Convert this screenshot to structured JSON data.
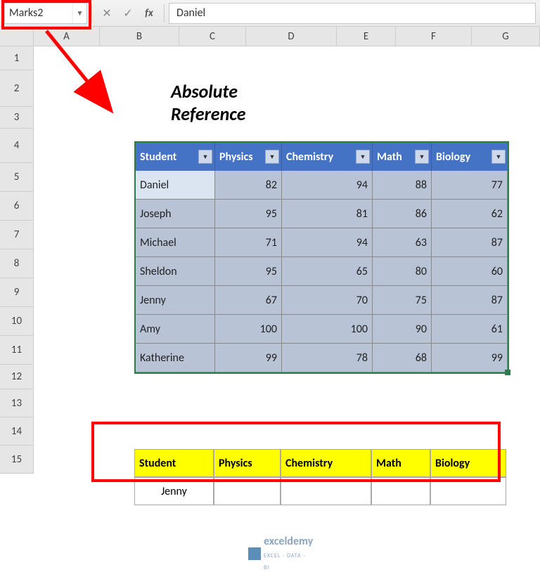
{
  "formula_bar": {
    "name_box": "Marks2",
    "formula_value": "Daniel",
    "cancel": "✕",
    "confirm": "✓",
    "fx": "fx"
  },
  "columns": [
    "A",
    "B",
    "C",
    "D",
    "E",
    "F",
    "G"
  ],
  "rows": [
    "1",
    "2",
    "3",
    "4",
    "5",
    "6",
    "7",
    "8",
    "9",
    "10",
    "11",
    "12",
    "13",
    "14",
    "15"
  ],
  "title": "Absolute Reference",
  "table": {
    "headers": [
      "Student",
      "Physics",
      "Chemistry",
      "Math",
      "Biology"
    ],
    "rows": [
      [
        "Daniel",
        "82",
        "94",
        "88",
        "77"
      ],
      [
        "Joseph",
        "95",
        "81",
        "86",
        "62"
      ],
      [
        "Michael",
        "71",
        "94",
        "63",
        "87"
      ],
      [
        "Sheldon",
        "95",
        "65",
        "80",
        "60"
      ],
      [
        "Jenny",
        "67",
        "70",
        "75",
        "87"
      ],
      [
        "Amy",
        "100",
        "100",
        "90",
        "61"
      ],
      [
        "Katherine",
        "99",
        "78",
        "68",
        "99"
      ]
    ]
  },
  "lookup": {
    "headers": [
      "Student",
      "Physics",
      "Chemistry",
      "Math",
      "Biology"
    ],
    "row": [
      "Jenny",
      "",
      "",
      "",
      ""
    ]
  },
  "logo": {
    "name": "exceldemy",
    "sub": "EXCEL · DATA · BI"
  },
  "colw": {
    "B": 113,
    "C": 95,
    "D": 129,
    "E": 84,
    "F": 108
  },
  "chart_data": {
    "type": "table",
    "title": "Absolute Reference",
    "columns": [
      "Student",
      "Physics",
      "Chemistry",
      "Math",
      "Biology"
    ],
    "rows": [
      {
        "Student": "Daniel",
        "Physics": 82,
        "Chemistry": 94,
        "Math": 88,
        "Biology": 77
      },
      {
        "Student": "Joseph",
        "Physics": 95,
        "Chemistry": 81,
        "Math": 86,
        "Biology": 62
      },
      {
        "Student": "Michael",
        "Physics": 71,
        "Chemistry": 94,
        "Math": 63,
        "Biology": 87
      },
      {
        "Student": "Sheldon",
        "Physics": 95,
        "Chemistry": 65,
        "Math": 80,
        "Biology": 60
      },
      {
        "Student": "Jenny",
        "Physics": 67,
        "Chemistry": 70,
        "Math": 75,
        "Biology": 87
      },
      {
        "Student": "Amy",
        "Physics": 100,
        "Chemistry": 100,
        "Math": 90,
        "Biology": 61
      },
      {
        "Student": "Katherine",
        "Physics": 99,
        "Chemistry": 78,
        "Math": 68,
        "Biology": 99
      }
    ]
  }
}
